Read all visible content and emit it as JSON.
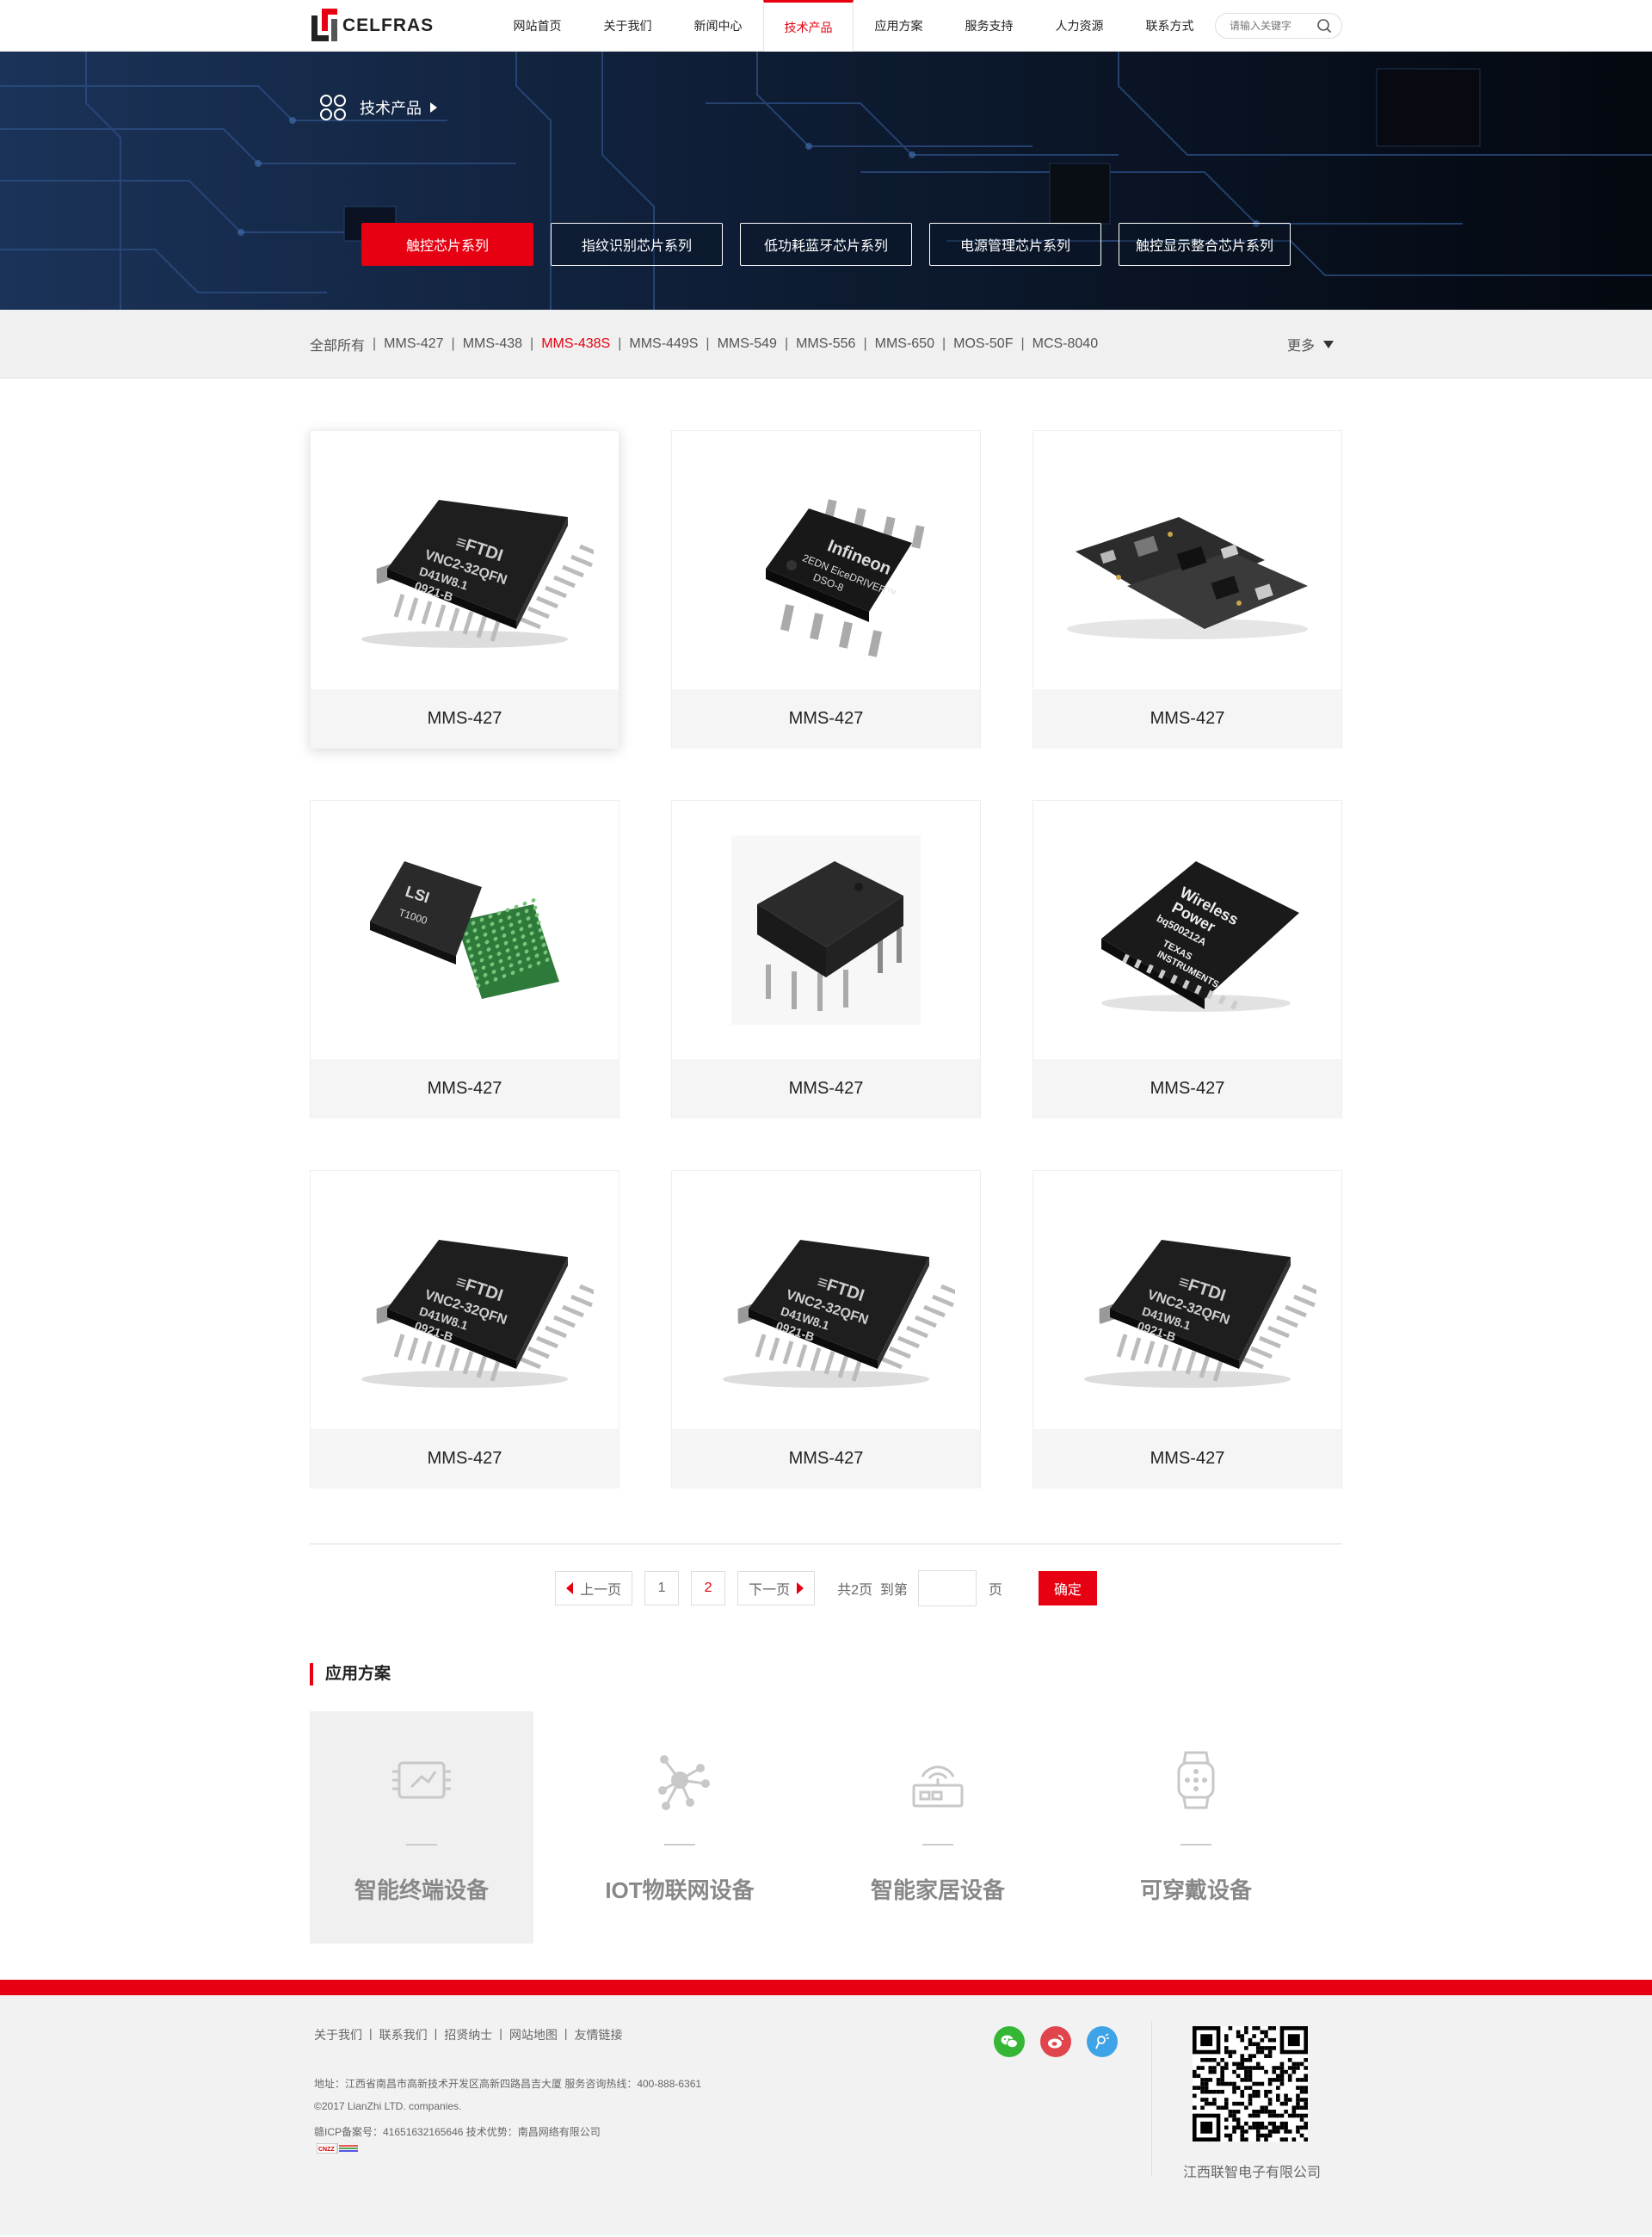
{
  "header": {
    "logo_text": "CELFRAS",
    "nav": [
      "网站首页",
      "关于我们",
      "新闻中心",
      "技术产品",
      "应用方案",
      "服务支持",
      "人力资源",
      "联系方式"
    ],
    "active_nav_index": 3,
    "search_placeholder": "请输入关键字"
  },
  "banner": {
    "breadcrumb": "技术产品",
    "tabs": [
      "触控芯片系列",
      "指纹识别芯片系列",
      "低功耗蓝牙芯片系列",
      "电源管理芯片系列",
      "触控显示整合芯片系列"
    ],
    "active_tab_index": 0
  },
  "filter": {
    "items": [
      "全部所有",
      "MMS-427",
      "MMS-438",
      "MMS-438S",
      "MMS-449S",
      "MMS-549",
      "MMS-556",
      "MMS-650",
      "MOS-50F",
      "MCS-8040"
    ],
    "active_index": 3,
    "separator": "|",
    "more_label": "更多"
  },
  "products": [
    {
      "name": "MMS-427",
      "img": "ftdi-chip-icon"
    },
    {
      "name": "MMS-427",
      "img": "infineon-chip-icon"
    },
    {
      "name": "MMS-427",
      "img": "circuit-board-icon"
    },
    {
      "name": "MMS-427",
      "img": "lsi-chip-icon"
    },
    {
      "name": "MMS-427",
      "img": "dip-chip-icon"
    },
    {
      "name": "MMS-427",
      "img": "ti-chip-icon"
    },
    {
      "name": "MMS-427",
      "img": "ftdi-chip-icon"
    },
    {
      "name": "MMS-427",
      "img": "ftdi-chip-icon"
    },
    {
      "name": "MMS-427",
      "img": "ftdi-chip-icon"
    }
  ],
  "chip_text": {
    "ftdi": {
      "brand": "≡FTDI",
      "l1": "VNC2-32QFN",
      "l2": "D41W8.1",
      "l3": "0921-B"
    },
    "infineon": {
      "brand": "Infineon",
      "l1": "2EDN EiceDRIVER™",
      "l2": "DSO-8"
    },
    "lsi": {
      "brand": "LSI",
      "l1": "T1000"
    },
    "ti": {
      "l1": "Wireless",
      "l2": "Power",
      "l3": "bq500212A",
      "l4": "TEXAS",
      "l5": "INSTRUMENTS"
    }
  },
  "pagination": {
    "prev": "上一页",
    "pages": [
      "1",
      "2"
    ],
    "current_page": "2",
    "next": "下一页",
    "total": "共2页",
    "goto": "到第",
    "page_unit": "页",
    "confirm": "确定"
  },
  "solutions": {
    "title": "应用方案",
    "items": [
      {
        "label": "智能终端设备",
        "icon": "smart-terminal-icon"
      },
      {
        "label": "IOT物联网设备",
        "icon": "iot-network-icon"
      },
      {
        "label": "智能家居设备",
        "icon": "smart-home-router-icon"
      },
      {
        "label": "可穿戴设备",
        "icon": "smartwatch-icon"
      }
    ],
    "active_index": 0
  },
  "footer": {
    "links": [
      "关于我们",
      "联系我们",
      "招贤纳士",
      "网站地图",
      "友情链接"
    ],
    "address": "地址：江西省南昌市高新技术开发区高新四路昌吉大厦    服务咨询热线：400-888-6361",
    "copyright": "©2017 LianZhi LTD. companies.",
    "icp": "赣ICP备案号：41651632165646    技术优势：南昌网络有限公司",
    "cnzz": "CNZZ",
    "company": "江西联智电子有限公司",
    "colors": {
      "wechat": "#35b634",
      "weibo": "#e0454b",
      "other": "#3fa3e8",
      "accent": "#e60012"
    }
  }
}
